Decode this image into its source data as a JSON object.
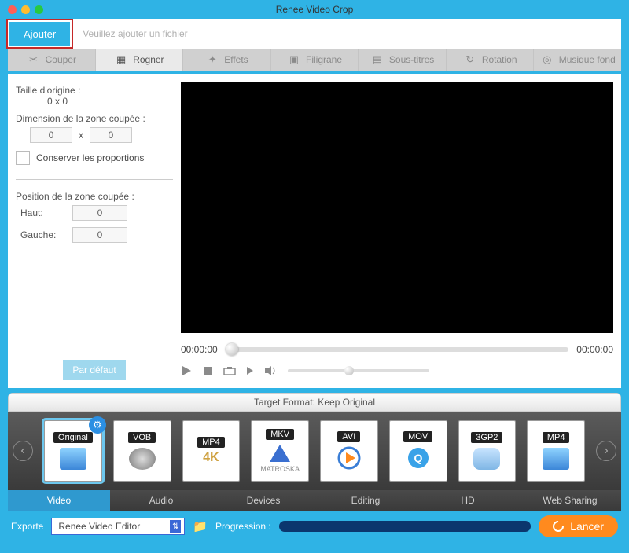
{
  "app_title": "Renee Video Crop",
  "add_button": "Ajouter",
  "add_placeholder": "Veuillez ajouter un fichier",
  "tabs": {
    "couper": "Couper",
    "rogner": "Rogner",
    "effets": "Effets",
    "filigrane": "Filigrane",
    "soustitres": "Sous-titres",
    "rotation": "Rotation",
    "musique": "Musique fond"
  },
  "panel": {
    "orig_label": "Taille d'origine :",
    "orig_value": "0 x 0",
    "crop_label": "Dimension de la zone coupée :",
    "w": "0",
    "x": "x",
    "h": "0",
    "keep_ratio": "Conserver les proportions",
    "pos_label": "Position de la zone coupée :",
    "top_label": "Haut:",
    "top_val": "0",
    "left_label": "Gauche:",
    "left_val": "0",
    "default_btn": "Par défaut"
  },
  "timeline": {
    "start": "00:00:00",
    "end": "00:00:00"
  },
  "target": {
    "label": "Target Format: Keep Original"
  },
  "formats": [
    "Original",
    "VOB",
    "MP4",
    "MKV",
    "AVI",
    "MOV",
    "3GP2",
    "MP4"
  ],
  "format_badges": [
    "",
    "",
    "4K",
    "MATROSKA",
    "",
    "",
    "",
    ""
  ],
  "bottom_tabs": [
    "Video",
    "Audio",
    "Devices",
    "Editing",
    "HD",
    "Web Sharing"
  ],
  "footer": {
    "export_label": "Exporte",
    "export_value": "Renee Video Editor",
    "progress_label": "Progression :",
    "launch": "Lancer"
  }
}
